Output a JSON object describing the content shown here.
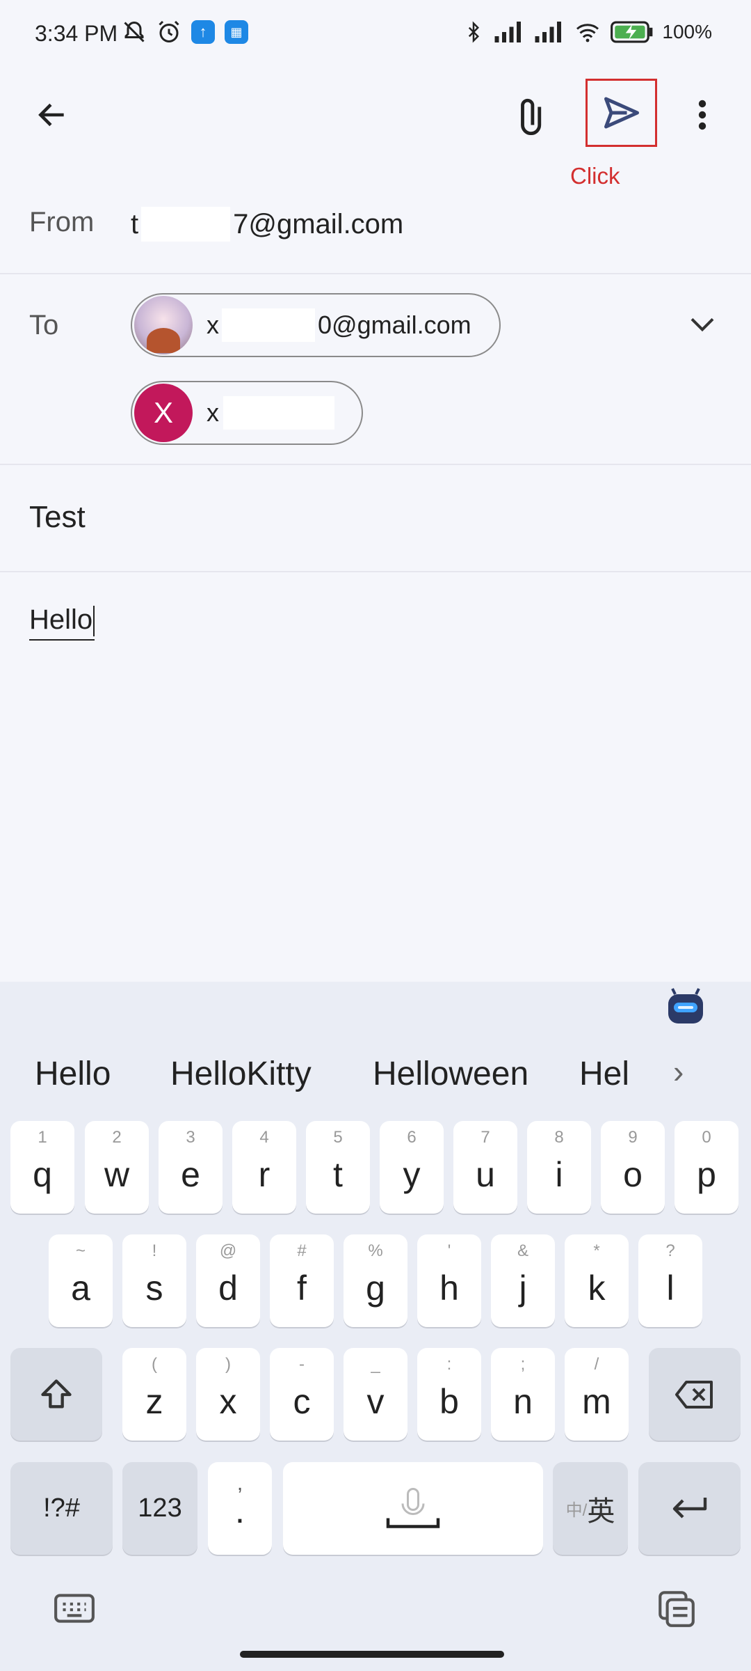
{
  "status_bar": {
    "time": "3:34 PM",
    "battery": "100%"
  },
  "toolbar": {
    "click_label": "Click"
  },
  "compose": {
    "from_label": "From",
    "from_prefix": "t",
    "from_suffix": "7@gmail.com",
    "to_label": "To",
    "recipients": [
      {
        "prefix": "x",
        "suffix": "0@gmail.com"
      },
      {
        "initial": "X",
        "prefix": "x"
      }
    ],
    "subject": "Test",
    "body": "Hello"
  },
  "keyboard": {
    "suggestions": [
      "Hello",
      "HelloKitty",
      "Helloween",
      "Hel"
    ],
    "row1": [
      {
        "k": "q",
        "h": "1"
      },
      {
        "k": "w",
        "h": "2"
      },
      {
        "k": "e",
        "h": "3"
      },
      {
        "k": "r",
        "h": "4"
      },
      {
        "k": "t",
        "h": "5"
      },
      {
        "k": "y",
        "h": "6"
      },
      {
        "k": "u",
        "h": "7"
      },
      {
        "k": "i",
        "h": "8"
      },
      {
        "k": "o",
        "h": "9"
      },
      {
        "k": "p",
        "h": "0"
      }
    ],
    "row2": [
      {
        "k": "a",
        "h": "~"
      },
      {
        "k": "s",
        "h": "!"
      },
      {
        "k": "d",
        "h": "@"
      },
      {
        "k": "f",
        "h": "#"
      },
      {
        "k": "g",
        "h": "%"
      },
      {
        "k": "h",
        "h": "'"
      },
      {
        "k": "j",
        "h": "&"
      },
      {
        "k": "k",
        "h": "*"
      },
      {
        "k": "l",
        "h": "?"
      }
    ],
    "row3": [
      {
        "k": "z",
        "h": "("
      },
      {
        "k": "x",
        "h": ")"
      },
      {
        "k": "c",
        "h": "-"
      },
      {
        "k": "v",
        "h": "_"
      },
      {
        "k": "b",
        "h": ":"
      },
      {
        "k": "n",
        "h": ";"
      },
      {
        "k": "m",
        "h": "/"
      }
    ],
    "symbols_label": "!?#",
    "numbers_label": "123",
    "punct_hint": ",",
    "punct_main": ".",
    "lang_small": "中/",
    "lang_big": "英"
  }
}
